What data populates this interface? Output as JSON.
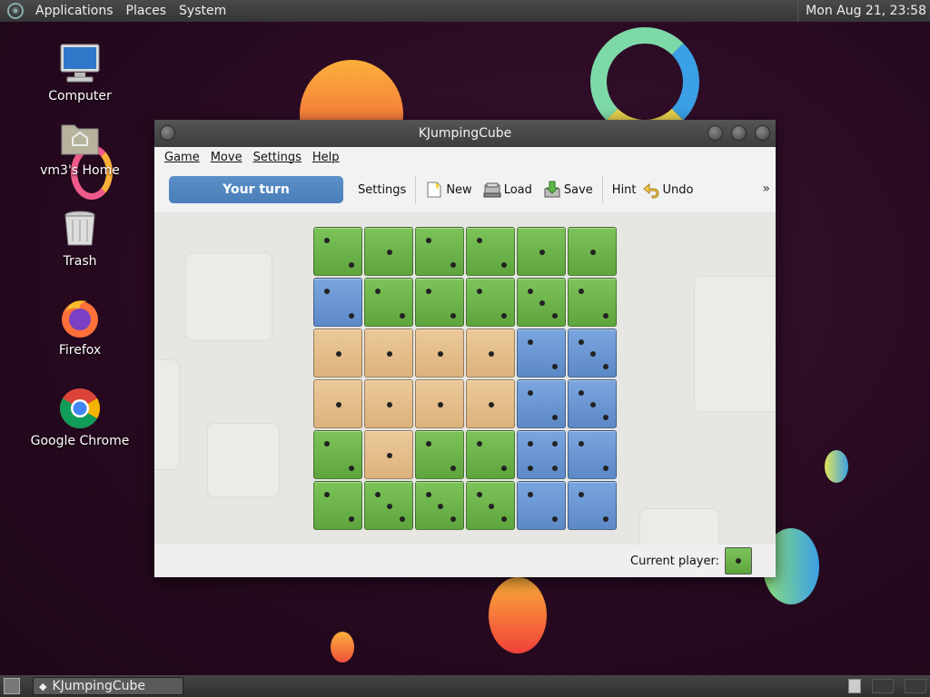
{
  "top_panel": {
    "menus": [
      "Applications",
      "Places",
      "System"
    ],
    "clock": "Mon Aug 21, 23:58"
  },
  "desktop_icons": [
    {
      "label": "Computer",
      "icon": "computer-icon"
    },
    {
      "label": "vm3's Home",
      "icon": "home-folder-icon"
    },
    {
      "label": "Trash",
      "icon": "trash-icon"
    },
    {
      "label": "Firefox",
      "icon": "firefox-icon"
    },
    {
      "label": "Google Chrome",
      "icon": "chrome-icon"
    }
  ],
  "window": {
    "title": "KJumpingCube",
    "menubar": [
      "Game",
      "Move",
      "Settings",
      "Help"
    ],
    "toolbar": {
      "turn_label": "Your turn",
      "settings": "Settings",
      "new": "New",
      "load": "Load",
      "save": "Save",
      "hint": "Hint",
      "undo": "Undo",
      "more": "»"
    },
    "board": {
      "rows": [
        [
          {
            "c": "green",
            "v": 2
          },
          {
            "c": "green",
            "v": 1
          },
          {
            "c": "green",
            "v": 2
          },
          {
            "c": "green",
            "v": 2
          },
          {
            "c": "green",
            "v": 1
          },
          {
            "c": "green",
            "v": 1
          }
        ],
        [
          {
            "c": "blue",
            "v": 2
          },
          {
            "c": "green",
            "v": 2
          },
          {
            "c": "green",
            "v": 2
          },
          {
            "c": "green",
            "v": 2
          },
          {
            "c": "green",
            "v": 3
          },
          {
            "c": "green",
            "v": 2
          }
        ],
        [
          {
            "c": "tan",
            "v": 1
          },
          {
            "c": "tan",
            "v": 1
          },
          {
            "c": "tan",
            "v": 1
          },
          {
            "c": "tan",
            "v": 1
          },
          {
            "c": "blue",
            "v": 2
          },
          {
            "c": "blue",
            "v": 3
          }
        ],
        [
          {
            "c": "tan",
            "v": 1
          },
          {
            "c": "tan",
            "v": 1
          },
          {
            "c": "tan",
            "v": 1
          },
          {
            "c": "tan",
            "v": 1
          },
          {
            "c": "blue",
            "v": 2
          },
          {
            "c": "blue",
            "v": 3
          }
        ],
        [
          {
            "c": "green",
            "v": 2
          },
          {
            "c": "tan",
            "v": 1
          },
          {
            "c": "green",
            "v": 2
          },
          {
            "c": "green",
            "v": 2
          },
          {
            "c": "blue",
            "v": 4
          },
          {
            "c": "blue",
            "v": 2
          }
        ],
        [
          {
            "c": "green",
            "v": 2
          },
          {
            "c": "green",
            "v": 3
          },
          {
            "c": "green",
            "v": 3
          },
          {
            "c": "green",
            "v": 3
          },
          {
            "c": "blue",
            "v": 2
          },
          {
            "c": "blue",
            "v": 2
          }
        ]
      ]
    },
    "status": {
      "current_player_label": "Current player:",
      "current_player_color": "green",
      "current_player_value": 1
    }
  },
  "taskbar": {
    "items": [
      {
        "label": "KJumpingCube",
        "icon": "kjumpingcube-icon"
      }
    ]
  },
  "colors": {
    "green": "#6cb54a",
    "blue": "#6a98d4",
    "tan": "#e6be8a",
    "turn_button": "#4f84bf"
  }
}
